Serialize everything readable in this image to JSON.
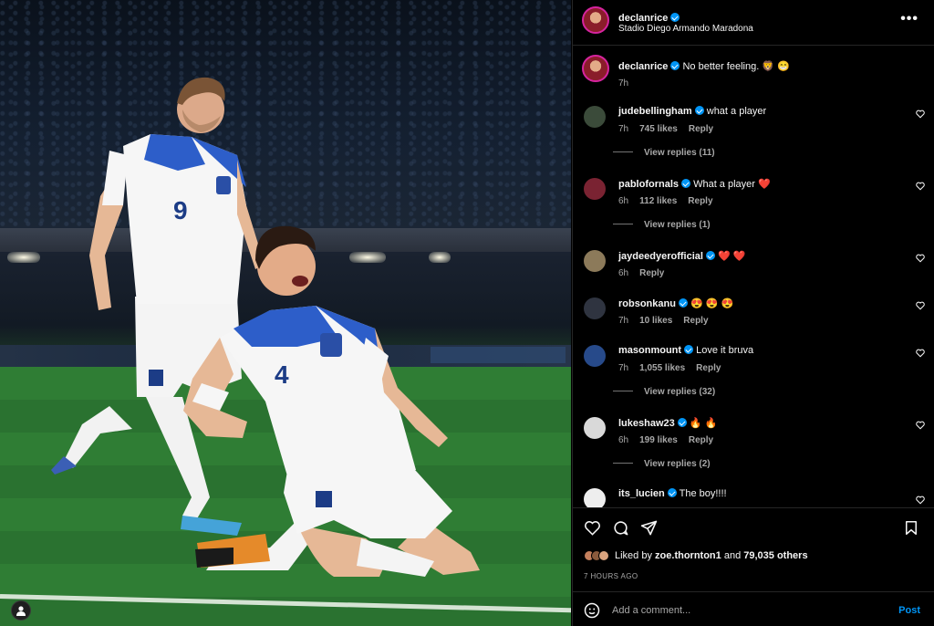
{
  "post": {
    "author": "declanrice",
    "location": "Stadio Diego Armando Maradona",
    "caption_author": "declanrice",
    "caption": "No better feeling. 🦁 😁",
    "caption_time": "7h",
    "player_numbers": [
      "9",
      "4"
    ]
  },
  "comments": [
    {
      "user": "judebellingham",
      "text": "what a player",
      "time": "7h",
      "likes": "745 likes",
      "reply": "Reply",
      "view_replies": "View replies (11)",
      "avatar_color": "#3b4b3a"
    },
    {
      "user": "pablofornals",
      "text": "What a player ❤️",
      "time": "6h",
      "likes": "112 likes",
      "reply": "Reply",
      "view_replies": "View replies (1)",
      "avatar_color": "#7a2332"
    },
    {
      "user": "jaydeedyerofficial",
      "text": "❤️ ❤️",
      "time": "6h",
      "likes": "",
      "reply": "Reply",
      "view_replies": "",
      "avatar_color": "#8c7a5a"
    },
    {
      "user": "robsonkanu",
      "text": "😍 😍 😍",
      "time": "7h",
      "likes": "10 likes",
      "reply": "Reply",
      "view_replies": "",
      "avatar_color": "#2f3440"
    },
    {
      "user": "masonmount",
      "text": "Love it bruva",
      "time": "7h",
      "likes": "1,055 likes",
      "reply": "Reply",
      "view_replies": "View replies (32)",
      "avatar_color": "#274a8a"
    },
    {
      "user": "lukeshaw23",
      "text": "🔥 🔥",
      "time": "6h",
      "likes": "199 likes",
      "reply": "Reply",
      "view_replies": "View replies (2)",
      "avatar_color": "#d9d9d9"
    },
    {
      "user": "its_lucien",
      "text": "The boy!!!!",
      "time": "",
      "likes": "",
      "reply": "",
      "view_replies": "",
      "avatar_color": "#eeeeee"
    }
  ],
  "likes": {
    "prefix": "Liked by",
    "user": "zoe.thornton1",
    "middle": "and",
    "count": "79,035 others"
  },
  "time_ago": "7 HOURS AGO",
  "compose": {
    "placeholder": "Add a comment...",
    "post_label": "Post"
  },
  "colors": {
    "accent": "#0095f6",
    "heart": "#ed4956",
    "ring": "#d6249f"
  },
  "icons": [
    "more-icon",
    "heart-icon",
    "comment-icon",
    "share-icon",
    "bookmark-icon",
    "emoji-icon",
    "user-icon",
    "verified-icon"
  ]
}
